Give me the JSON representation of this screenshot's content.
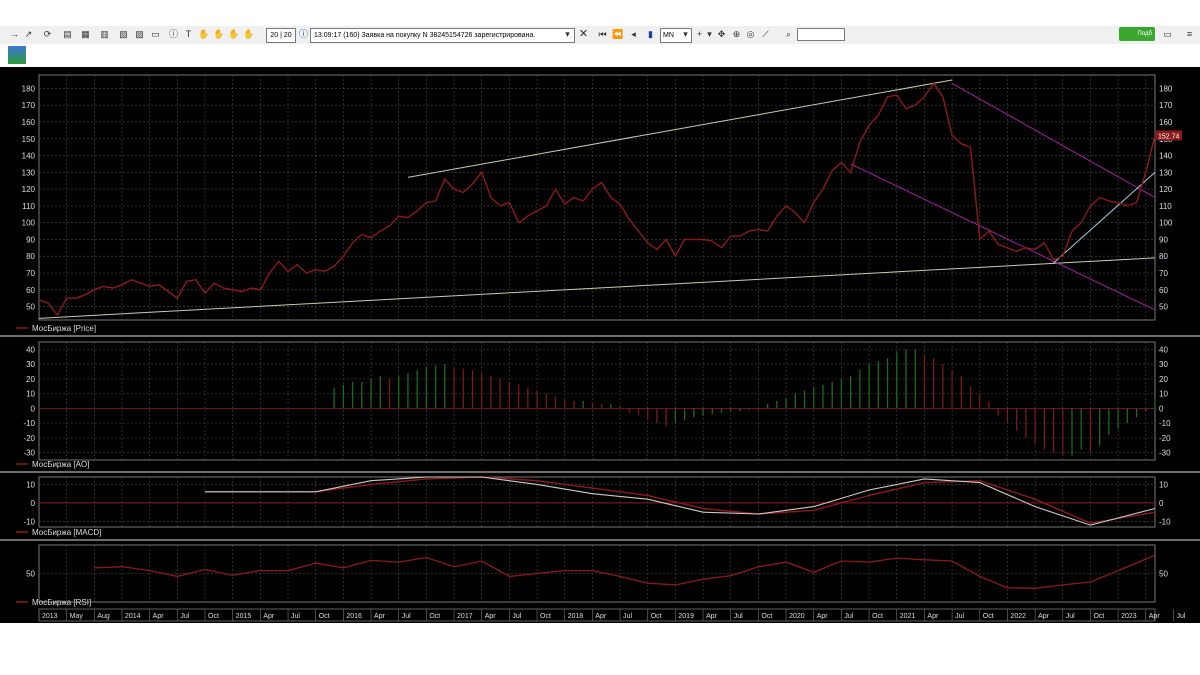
{
  "toolbar": {
    "order_count": "20 | 20",
    "message": "13:09:17  (160) Заявка на покупку N 38245154726 зарегистрирована.",
    "timeframe": "MN",
    "status_button": "Подб"
  },
  "colors": {
    "price": "#8b1a1a",
    "trend_line": "#ccccaa",
    "channel": "#a020a0",
    "ao_green": "#1c6b1c",
    "ao_red": "#7a1a1a",
    "macd_signal": "#cccccc",
    "background": "#000000",
    "grid": "#4a4a4a"
  },
  "chart_data": [
    {
      "type": "line",
      "legend": "МосБиржа [Price]",
      "last_value_label": "152.74",
      "yticks": [
        50,
        60,
        70,
        80,
        90,
        100,
        110,
        120,
        130,
        140,
        150,
        160,
        170,
        180
      ],
      "ylim": [
        42,
        188
      ],
      "x": [
        0,
        1,
        2,
        3,
        4,
        5,
        6,
        7,
        8,
        9,
        10,
        11,
        12,
        13,
        14,
        15,
        16,
        17,
        18,
        19,
        20,
        21,
        22,
        23,
        24,
        25,
        26,
        27,
        28,
        29,
        30,
        31,
        32,
        33,
        34,
        35,
        36,
        37,
        38,
        39,
        40,
        41,
        42,
        43,
        44,
        45,
        46,
        47,
        48,
        49,
        50,
        51,
        52,
        53,
        54,
        55,
        56,
        57,
        58,
        59,
        60,
        61,
        62,
        63,
        64,
        65,
        66,
        67,
        68,
        69,
        70,
        71,
        72,
        73,
        74,
        75,
        76,
        77,
        78,
        79,
        80,
        81,
        82,
        83,
        84,
        85,
        86,
        87,
        88,
        89,
        90,
        91,
        92,
        93,
        94,
        95,
        96,
        97,
        98,
        99,
        100,
        101,
        102,
        103,
        104,
        105,
        106,
        107,
        108,
        109,
        110,
        111,
        112,
        113,
        114,
        115,
        116,
        117,
        118,
        119,
        120,
        121
      ],
      "values": [
        54,
        52,
        45,
        55,
        55,
        57,
        60,
        62,
        61,
        63,
        66,
        64,
        62,
        63,
        59,
        55,
        65,
        66,
        58,
        64,
        61,
        60,
        59,
        61,
        60,
        70,
        77,
        71,
        75,
        70,
        72,
        71,
        74,
        80,
        88,
        93,
        91,
        95,
        98,
        104,
        103,
        107,
        112,
        113,
        126,
        120,
        118,
        123,
        130,
        115,
        110,
        112,
        100,
        104,
        107,
        110,
        120,
        111,
        115,
        113,
        120,
        124,
        115,
        111,
        102,
        95,
        88,
        84,
        90,
        80,
        90,
        90,
        90,
        89,
        85,
        92,
        92,
        95,
        96,
        95,
        104,
        110,
        106,
        100,
        112,
        120,
        131,
        136,
        130,
        148,
        158,
        164,
        175,
        176,
        168,
        170,
        175,
        183,
        175,
        152,
        147,
        145,
        90,
        95,
        87,
        85,
        83,
        85,
        84,
        88,
        78,
        80,
        95,
        100,
        110,
        115,
        113,
        112,
        110,
        112,
        130,
        152
      ]
    },
    {
      "type": "bar",
      "legend": "МосБиржа [AO]",
      "yticks": [
        -30,
        -20,
        -10,
        0,
        10,
        20,
        30,
        40
      ],
      "ylim": [
        -35,
        45
      ],
      "x": [
        32,
        33,
        34,
        35,
        36,
        37,
        38,
        39,
        40,
        41,
        42,
        43,
        44,
        45,
        46,
        47,
        48,
        49,
        50,
        51,
        52,
        53,
        54,
        55,
        56,
        57,
        58,
        59,
        60,
        61,
        62,
        63,
        64,
        65,
        66,
        67,
        68,
        69,
        70,
        71,
        72,
        73,
        74,
        75,
        76,
        77,
        78,
        79,
        80,
        81,
        82,
        83,
        84,
        85,
        86,
        87,
        88,
        89,
        90,
        91,
        92,
        93,
        94,
        95,
        96,
        97,
        98,
        99,
        100,
        101,
        102,
        103,
        104,
        105,
        106,
        107,
        108,
        109,
        110,
        111,
        112,
        113,
        114,
        115,
        116,
        117,
        118,
        119,
        120,
        121
      ],
      "values": [
        14,
        16,
        18,
        18,
        20,
        22,
        20,
        22,
        24,
        26,
        28,
        29,
        30,
        28,
        27,
        26,
        24,
        22,
        20,
        18,
        16,
        14,
        12,
        10,
        8,
        6,
        5,
        5,
        4,
        3,
        3,
        2,
        -3,
        -5,
        -8,
        -10,
        -12,
        -10,
        -8,
        -6,
        -5,
        -4,
        -3,
        -2,
        -2,
        -1,
        -2,
        3,
        5,
        7,
        10,
        12,
        14,
        16,
        18,
        20,
        22,
        26,
        30,
        32,
        34,
        38,
        40,
        40,
        36,
        34,
        30,
        26,
        22,
        15,
        10,
        5,
        -5,
        -10,
        -15,
        -20,
        -24,
        -28,
        -30,
        -32,
        -32,
        -28,
        -30,
        -25,
        -18,
        -14,
        -10,
        -6,
        -2,
        6
      ]
    },
    {
      "type": "line",
      "legend": "МосБиржа [MACD]",
      "yticks": [
        -10,
        0,
        10
      ],
      "ylim": [
        -13,
        14
      ],
      "x": [
        18,
        24,
        30,
        36,
        42,
        48,
        54,
        60,
        66,
        72,
        78,
        84,
        90,
        96,
        102,
        108,
        114,
        121
      ],
      "values": [
        6,
        6,
        6,
        12,
        14,
        14,
        10,
        5,
        2,
        -5,
        -6,
        -2,
        7,
        13,
        11,
        -2,
        -12,
        -3
      ],
      "series": [
        {
          "values": [
            6,
            6,
            6,
            12,
            14,
            14,
            10,
            5,
            2,
            -5,
            -6,
            -2,
            7,
            13,
            11,
            -2,
            -12,
            -3
          ]
        },
        {
          "values": [
            6,
            6,
            6,
            10,
            13,
            14,
            12,
            8,
            4,
            -3,
            -6,
            -4,
            4,
            11,
            12,
            2,
            -11,
            -5
          ]
        }
      ]
    },
    {
      "type": "line",
      "legend": "МосБиржа [RSI]",
      "yticks": [
        50
      ],
      "ylim": [
        0,
        100
      ],
      "x": [
        6,
        9,
        12,
        15,
        18,
        21,
        24,
        27,
        30,
        33,
        36,
        39,
        42,
        45,
        48,
        51,
        54,
        57,
        60,
        63,
        66,
        69,
        72,
        75,
        78,
        81,
        84,
        87,
        90,
        93,
        96,
        99,
        102,
        105,
        108,
        111,
        114,
        117,
        121
      ],
      "values": [
        60,
        62,
        55,
        45,
        57,
        47,
        55,
        55,
        68,
        60,
        73,
        70,
        78,
        62,
        72,
        45,
        50,
        55,
        55,
        45,
        33,
        30,
        40,
        46,
        62,
        70,
        52,
        72,
        70,
        77,
        74,
        72,
        45,
        25,
        24,
        30,
        35,
        55,
        82
      ],
      "xticklabels": [
        "2013",
        "May",
        "Aug",
        "2014",
        "Apr",
        "Jul",
        "Oct",
        "2015",
        "Apr",
        "Jul",
        "Oct",
        "2016",
        "Apr",
        "Jul",
        "Oct",
        "2017",
        "Apr",
        "Jul",
        "Oct",
        "2018",
        "Apr",
        "Jul",
        "Oct",
        "2019",
        "Apr",
        "Jul",
        "Oct",
        "2020",
        "Apr",
        "Jul",
        "Oct",
        "2021",
        "Apr",
        "Jul",
        "Oct",
        "2022",
        "Apr",
        "Jul",
        "Oct",
        "2023",
        "Apr",
        "Jul"
      ]
    }
  ]
}
